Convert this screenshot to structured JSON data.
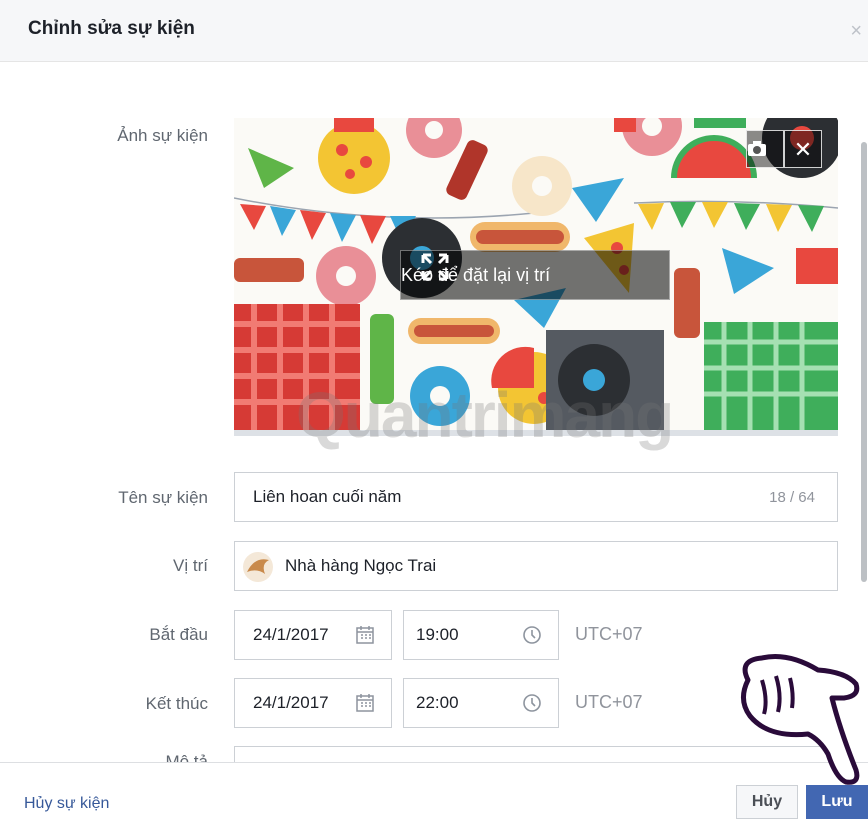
{
  "dialog": {
    "title": "Chỉnh sửa sự kiện",
    "close_icon": "×"
  },
  "labels": {
    "photo": "Ảnh sự kiện",
    "name": "Tên sự kiện",
    "location": "Vị trí",
    "start": "Bắt đầu",
    "end": "Kết thúc",
    "description": "Mô tả"
  },
  "photo": {
    "reposition_label": "Kéo để đặt lại vị trí",
    "camera_icon": "camera-icon",
    "remove_icon": "close-icon"
  },
  "watermark": "Quantrimang",
  "name_field": {
    "value": "Liên hoan cuối năm",
    "counter": "18 / 64"
  },
  "location_field": {
    "value": "Nhà hàng Ngọc Trai"
  },
  "start": {
    "date": "24/1/2017",
    "time": "19:00",
    "timezone": "UTC+07"
  },
  "end": {
    "date": "24/1/2017",
    "time": "22:00",
    "timezone": "UTC+07"
  },
  "footer": {
    "delete_label": "Hủy sự kiện",
    "cancel_label": "Hủy",
    "save_label": "Lưu"
  },
  "colors": {
    "primary": "#4267b2",
    "link": "#365899",
    "border": "#ccd0d5"
  }
}
